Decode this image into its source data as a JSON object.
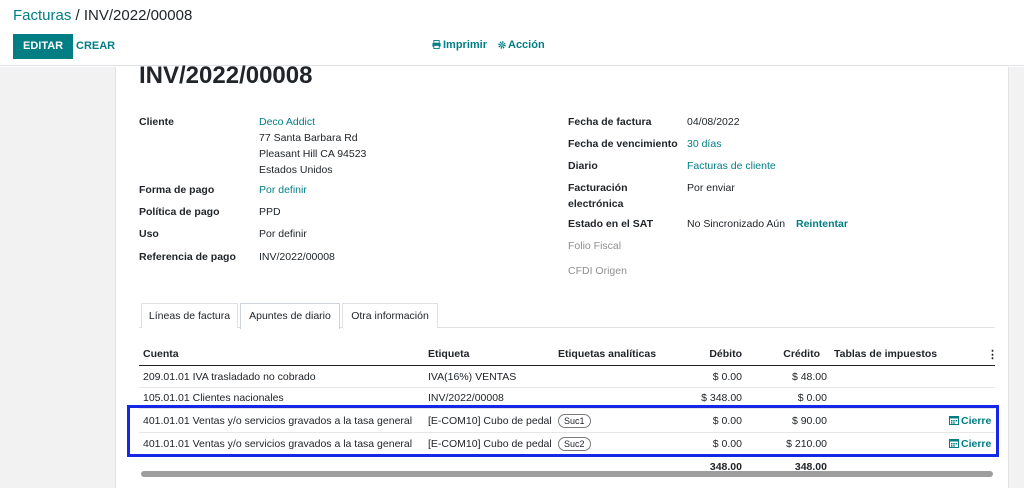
{
  "breadcrumb": {
    "root": "Facturas",
    "separator": " / ",
    "current": "INV/2022/00008"
  },
  "toolbar": {
    "edit_label": "EDITAR",
    "create_label": "CREAR",
    "print_label": "Imprimir",
    "action_label": "Acción"
  },
  "document": {
    "title": "INV/2022/00008",
    "left": {
      "customer_label": "Cliente",
      "customer_name": "Deco Addict",
      "address_line1": "77 Santa Barbara Rd",
      "address_line2": "Pleasant Hill CA 94523",
      "address_line3": "Estados Unidos",
      "payment_form_label": "Forma de pago",
      "payment_form_value": "Por definir",
      "payment_policy_label": "Política de pago",
      "payment_policy_value": "PPD",
      "usage_label": "Uso",
      "usage_value": "Por definir",
      "payment_ref_label": "Referencia de pago",
      "payment_ref_value": "INV/2022/00008"
    },
    "right": {
      "invoice_date_label": "Fecha de factura",
      "invoice_date_value": "04/08/2022",
      "due_date_label": "Fecha de vencimiento",
      "due_date_value": "30 días",
      "journal_label": "Diario",
      "journal_value": "Facturas de cliente",
      "einvoice_label_line1": "Facturación",
      "einvoice_label_line2": "electrónica",
      "einvoice_value": "Por enviar",
      "sat_label": "Estado en el SAT",
      "sat_value": "No Sincronizado Aún",
      "sat_retry": "Reintentar",
      "fiscal_folio_label": "Folio Fiscal",
      "cfdi_origin_label": "CFDI Origen"
    }
  },
  "tabs": [
    {
      "label": "Líneas de factura"
    },
    {
      "label": "Apuntes de diario",
      "active": true
    },
    {
      "label": "Otra información"
    }
  ],
  "table": {
    "headers": {
      "account": "Cuenta",
      "label": "Etiqueta",
      "analytic_tags": "Etiquetas analíticas",
      "debit": "Débito",
      "credit": "Crédito",
      "tax_grids": "Tablas de impuestos"
    },
    "rows": [
      {
        "account": "209.01.01 IVA trasladado no cobrado",
        "label": "IVA(16%) VENTAS",
        "tag": "",
        "debit": "$ 0.00",
        "credit": "$ 48.00",
        "action": ""
      },
      {
        "account": "105.01.01 Clientes nacionales",
        "label": "INV/2022/00008",
        "tag": "",
        "debit": "$ 348.00",
        "credit": "$ 0.00",
        "action": ""
      },
      {
        "account": "401.01.01 Ventas y/o servicios gravados a la tasa general",
        "label": "[E-COM10] Cubo de pedal",
        "tag": "Suc1",
        "debit": "$ 0.00",
        "credit": "$ 90.00",
        "action": "Cierre"
      },
      {
        "account": "401.01.01 Ventas y/o servicios gravados a la tasa general",
        "label": "[E-COM10] Cubo de pedal",
        "tag": "Suc2",
        "debit": "$ 0.00",
        "credit": "$ 210.00",
        "action": "Cierre"
      }
    ],
    "totals": {
      "debit": "348.00",
      "credit": "348.00"
    }
  },
  "colors": {
    "accent": "#017e84",
    "highlight_border": "#1428e6"
  }
}
